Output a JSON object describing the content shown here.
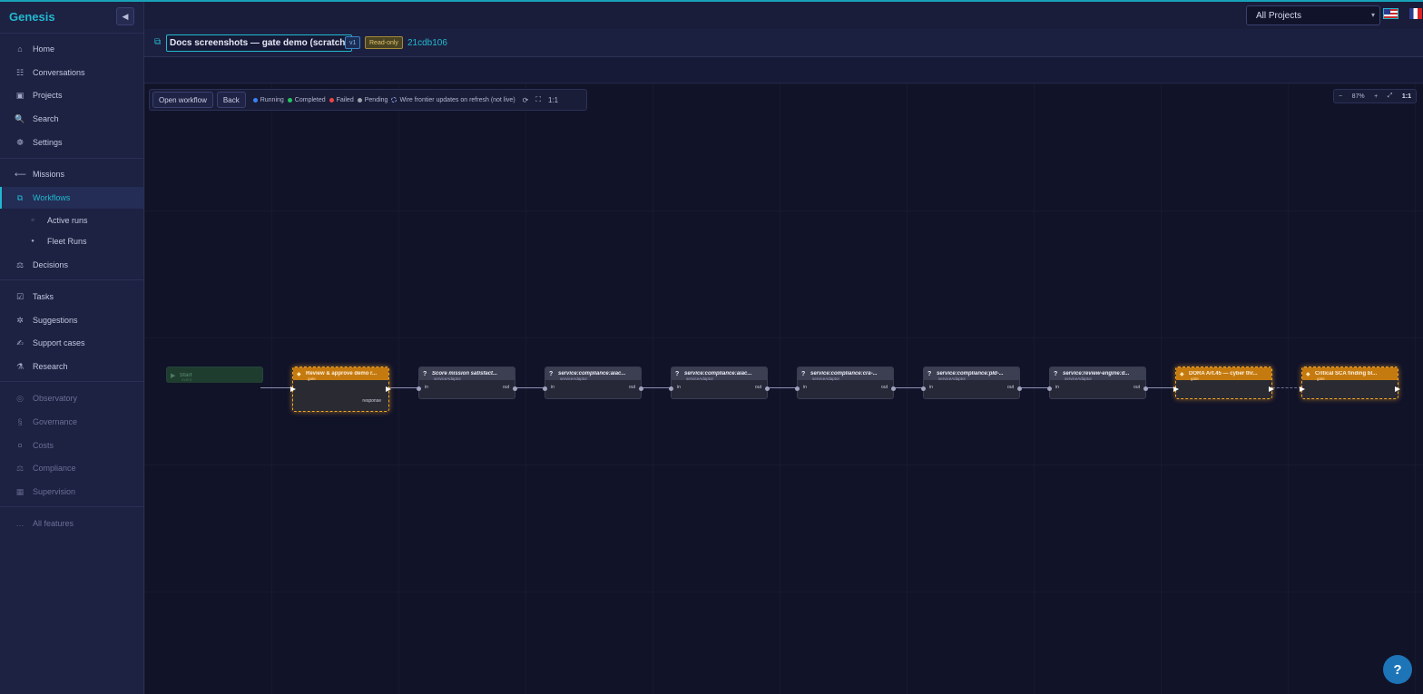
{
  "sidebar": {
    "brand": "Genesis",
    "collapse_icon": "◀",
    "items": [
      {
        "label": "Home",
        "icon": "⌂"
      },
      {
        "label": "Conversations",
        "icon": "☷"
      },
      {
        "label": "Projects",
        "icon": "▣"
      },
      {
        "label": "Search",
        "icon": "🔍"
      },
      {
        "label": "Settings",
        "icon": "❁"
      },
      {
        "label": "Missions",
        "icon": "⟵"
      },
      {
        "label": "Workflows",
        "icon": "⧉"
      },
      {
        "label": "Active runs",
        "icon": "○"
      },
      {
        "label": "Fleet Runs",
        "icon": "●"
      },
      {
        "label": "Decisions",
        "icon": "⚖"
      },
      {
        "label": "Tasks",
        "icon": "☑"
      },
      {
        "label": "Suggestions",
        "icon": "✲"
      },
      {
        "label": "Support cases",
        "icon": "✍"
      },
      {
        "label": "Research",
        "icon": "⚗"
      },
      {
        "label": "Observatory",
        "icon": "◎"
      },
      {
        "label": "Governance",
        "icon": "§"
      },
      {
        "label": "Costs",
        "icon": "¤"
      },
      {
        "label": "Compliance",
        "icon": "⚖"
      },
      {
        "label": "Supervision",
        "icon": "▦"
      },
      {
        "label": "All features",
        "icon": "…"
      }
    ]
  },
  "topbar": {
    "project_select": "All Projects"
  },
  "workflow": {
    "title": "Docs screenshots — gate demo (scratch)",
    "version": "v1",
    "readonly": "Read-only",
    "hash": "21cdb106"
  },
  "toolbar": {
    "open_workflow": "Open workflow",
    "back": "Back",
    "legend": [
      {
        "label": "Running",
        "color": "#3b82f6"
      },
      {
        "label": "Completed",
        "color": "#22c55e"
      },
      {
        "label": "Failed",
        "color": "#ef4444"
      },
      {
        "label": "Pending",
        "color": "#9ca3af"
      }
    ],
    "frontier_note": "Wire frontier updates on refresh (not live)",
    "ratio": "1:1"
  },
  "zoom": {
    "minus": "−",
    "level": "87%",
    "plus": "+",
    "fit": "⤢",
    "ratio": "1:1"
  },
  "nodes": [
    {
      "kind": "start",
      "icon": "▶",
      "title": "Start",
      "subtitle": "event"
    },
    {
      "kind": "gate",
      "icon": "◆",
      "title": "Review & approve demo r...",
      "subtitle": "gate",
      "out": "response"
    },
    {
      "kind": "service",
      "icon": "?",
      "title": "Score mission satisfact...",
      "subtitle": "serviceAdaptor",
      "in": "in",
      "out": "out"
    },
    {
      "kind": "service",
      "icon": "?",
      "title": "service:compliance:aiac...",
      "subtitle": "serviceAdaptor",
      "in": "in",
      "out": "out"
    },
    {
      "kind": "service",
      "icon": "?",
      "title": "service:compliance:aiac...",
      "subtitle": "serviceAdaptor",
      "in": "in",
      "out": "out"
    },
    {
      "kind": "service",
      "icon": "?",
      "title": "service:compliance:cra-...",
      "subtitle": "serviceAdaptor",
      "in": "in",
      "out": "out"
    },
    {
      "kind": "service",
      "icon": "?",
      "title": "service:compliance:pld-...",
      "subtitle": "serviceAdaptor",
      "in": "in",
      "out": "out"
    },
    {
      "kind": "service",
      "icon": "?",
      "title": "service:review-engine:d...",
      "subtitle": "serviceAdaptor",
      "in": "in",
      "out": "out"
    },
    {
      "kind": "gate",
      "icon": "◆",
      "title": "DORA Art.45 — cyber thr...",
      "subtitle": "gate"
    },
    {
      "kind": "gate",
      "icon": "◆",
      "title": "Critical SCA finding bl...",
      "subtitle": "gate"
    }
  ],
  "help": "?"
}
